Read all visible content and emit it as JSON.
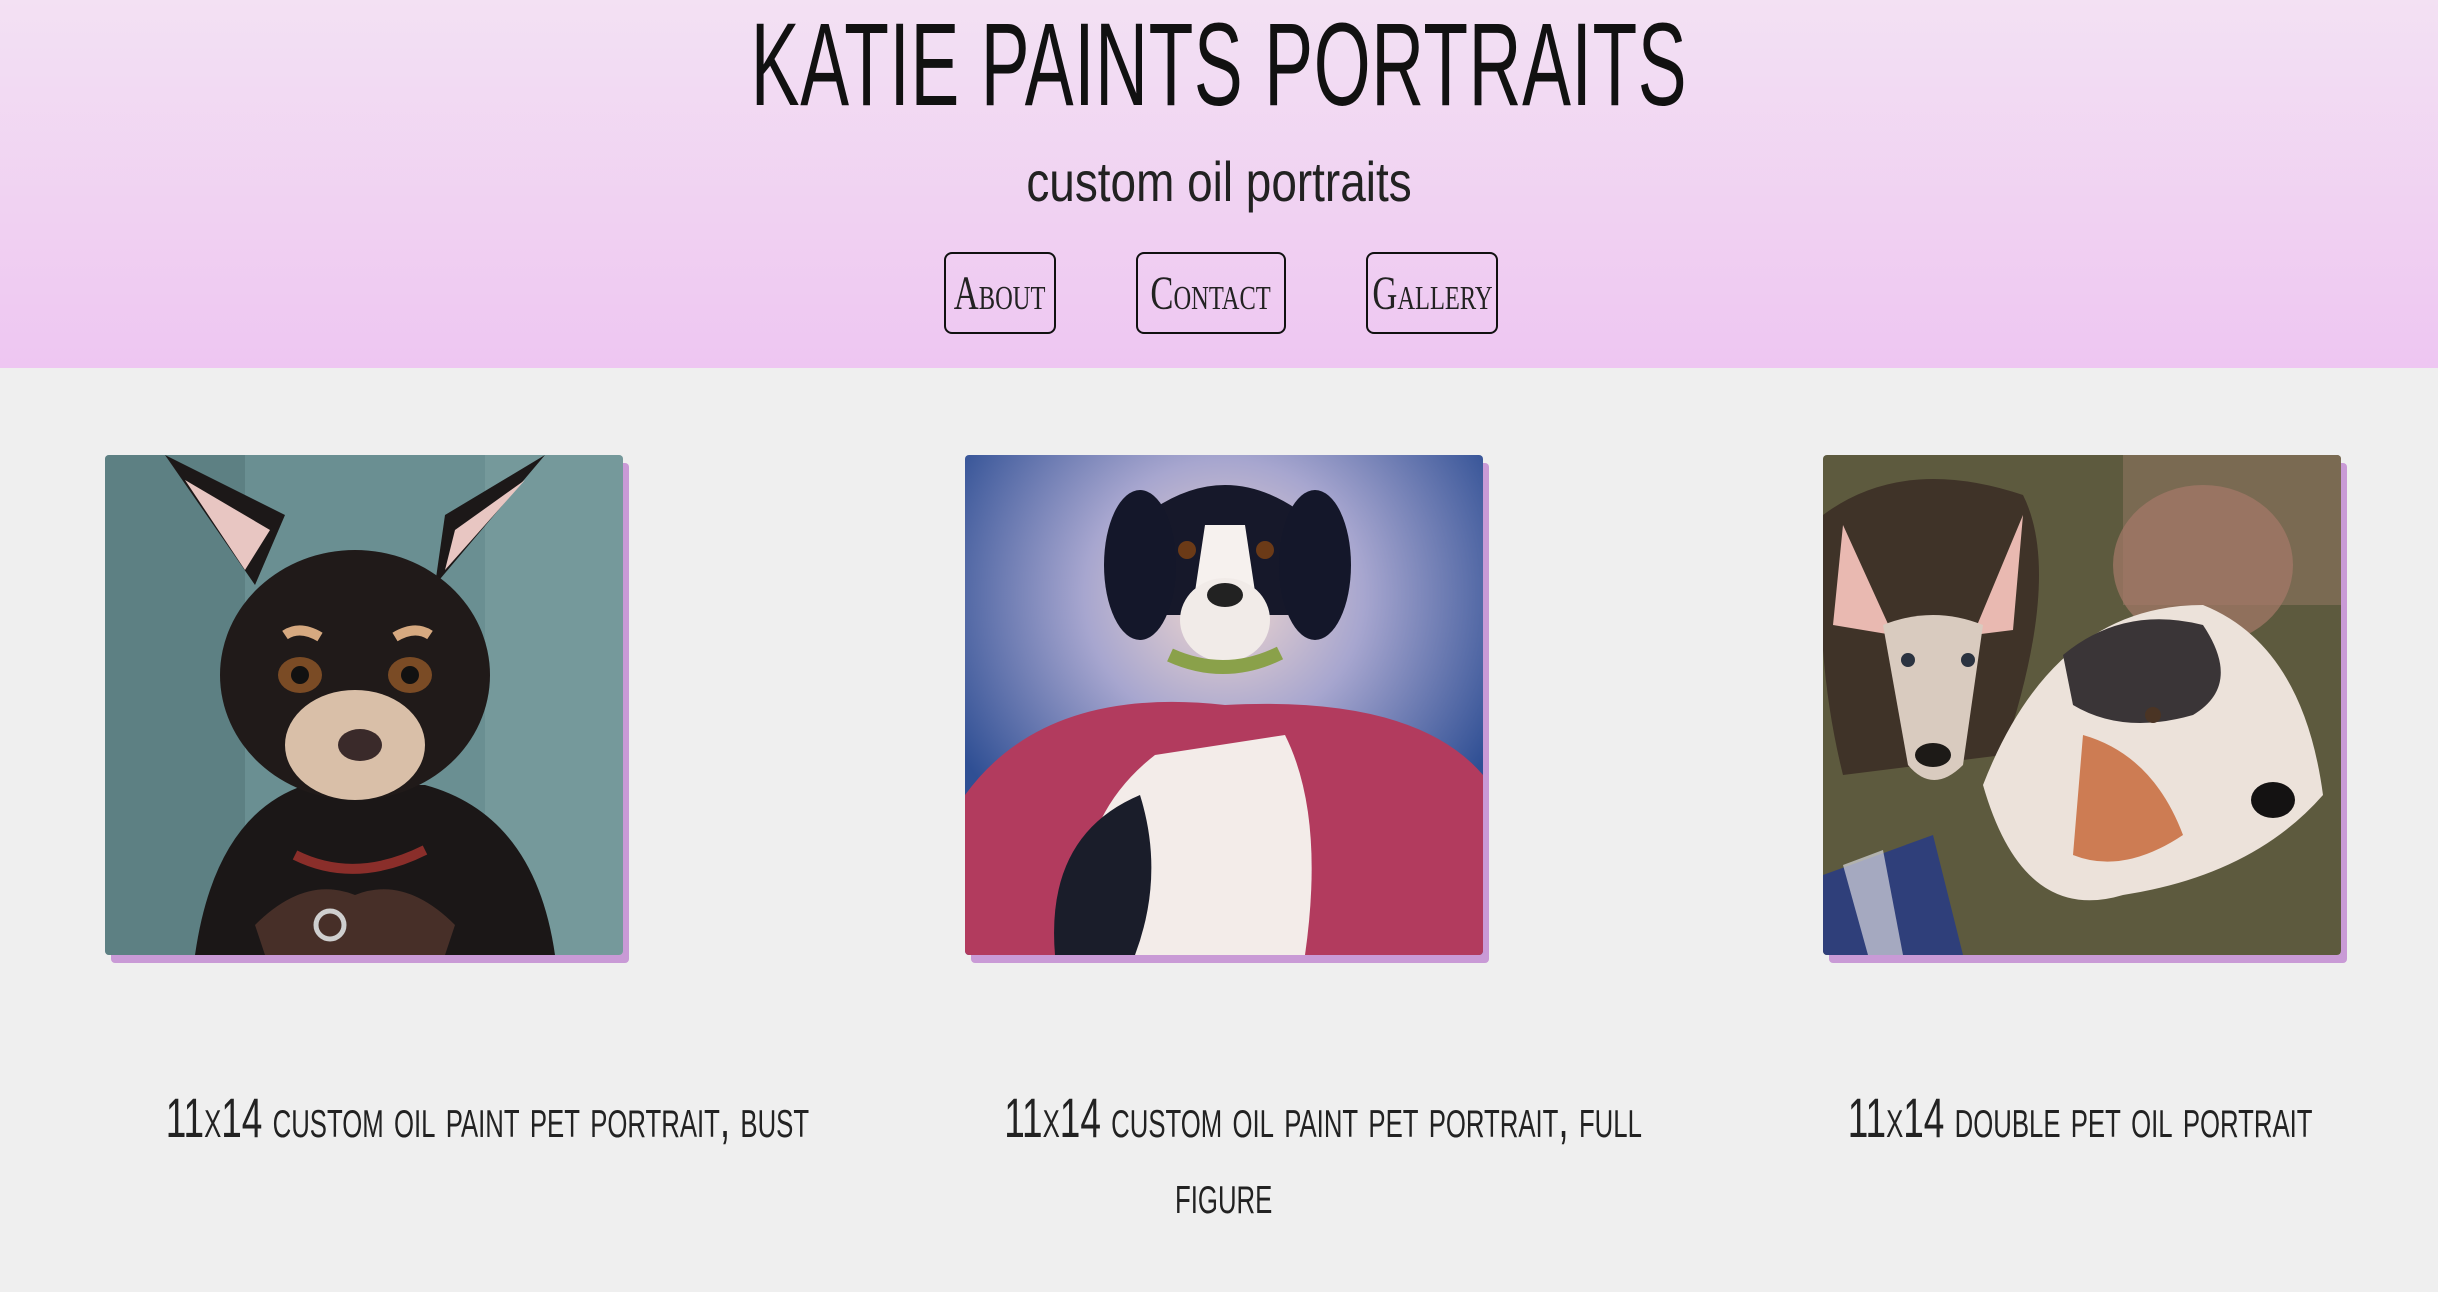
{
  "header": {
    "title": "Katie Paints Portraits",
    "subtitle": "custom oil portraits"
  },
  "nav": {
    "about": "About",
    "contact": "Contact",
    "gallery": "Gallery"
  },
  "products": [
    {
      "caption": "11x14 custom oil paint pet portrait, bust",
      "image": "chihuahua-portrait-painting"
    },
    {
      "caption_line1": "11x14 custom oil paint pet portrait, full",
      "caption_line2": "figure",
      "image": "beagle-portrait-painting"
    },
    {
      "caption": "11x14 double pet oil portrait",
      "image": "husky-and-aussie-portrait-painting"
    }
  ],
  "colors": {
    "header_top": "#f3e1f3",
    "header_bottom": "#eec6f2",
    "page_background": "#efefef",
    "image_shadow": "#c99ad6"
  }
}
